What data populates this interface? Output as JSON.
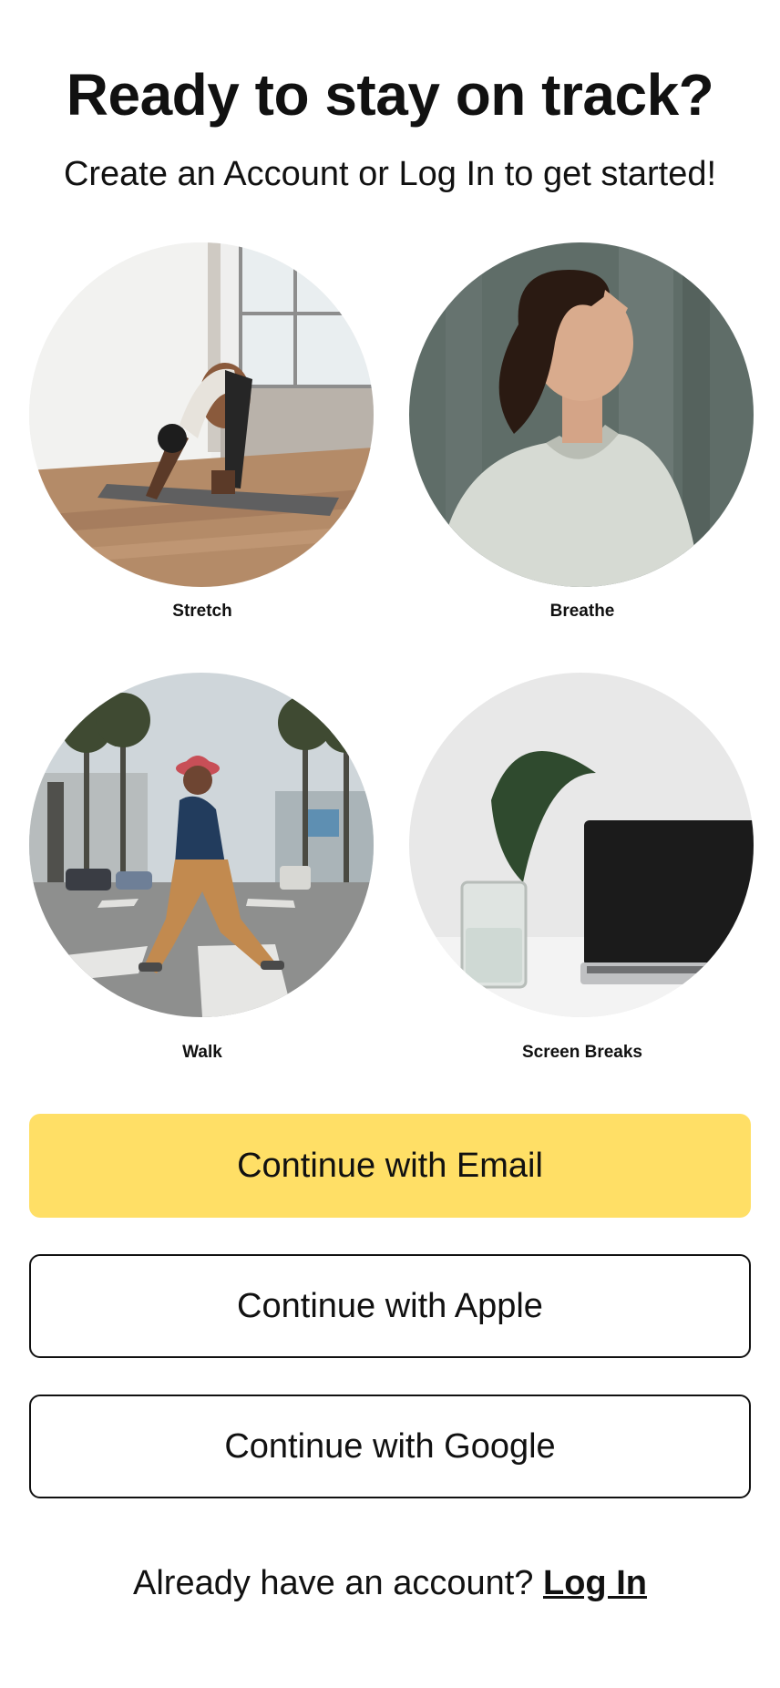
{
  "header": {
    "title": "Ready to stay on track?",
    "subtitle": "Create an Account or Log In to get started!"
  },
  "activities": [
    {
      "label": "Stretch",
      "image": "stretch-photo"
    },
    {
      "label": "Breathe",
      "image": "breathe-photo"
    },
    {
      "label": "Walk",
      "image": "walk-photo"
    },
    {
      "label": "Screen Breaks",
      "image": "screen-breaks-photo"
    }
  ],
  "buttons": {
    "email": "Continue with Email",
    "apple": "Continue with Apple",
    "google": "Continue with Google"
  },
  "footer": {
    "prompt": "Already have an account?",
    "login": "Log In"
  },
  "colors": {
    "accent": "#FFDF66",
    "text": "#111111",
    "background": "#FFFFFF"
  }
}
